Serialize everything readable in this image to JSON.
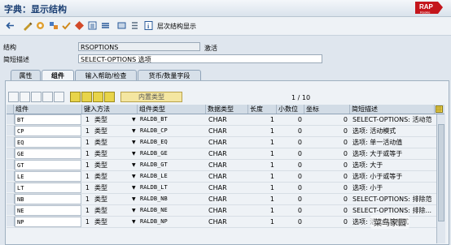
{
  "window": {
    "title": "字典：显示结构"
  },
  "logo": {
    "top": "RAP",
    "bottom": "Rookie"
  },
  "toolbar": {
    "hierarchy_label": "层次结构显示"
  },
  "header": {
    "structure_label": "结构",
    "structure_value": "RSOPTIONS",
    "status": "激活",
    "short_desc_label": "简短描述",
    "short_desc_value": "SELECT-OPTIONS 选项"
  },
  "tabs": [
    {
      "label": "属性",
      "active": false
    },
    {
      "label": "组件",
      "active": true
    },
    {
      "label": "输入帮助/检查",
      "active": false
    },
    {
      "label": "货币/数量字段",
      "active": false
    }
  ],
  "table_toolbar": {
    "builtin_type_label": "内置类型",
    "page_info": "1 / 10"
  },
  "table": {
    "columns": [
      "组件",
      "键入方法",
      "组件类型",
      "数据类型",
      "长度",
      "小数位",
      "坐标",
      "简短描述"
    ],
    "rows": [
      {
        "component": "BT",
        "method_num": "1",
        "method": "类型",
        "type": "RALDB_BT",
        "dtype": "CHAR",
        "len": "1",
        "dec": "0",
        "coord": "0",
        "desc": "SELECT-OPTIONS: 活动范"
      },
      {
        "component": "CP",
        "method_num": "1",
        "method": "类型",
        "type": "RALDB_CP",
        "dtype": "CHAR",
        "len": "1",
        "dec": "0",
        "coord": "0",
        "desc": "选项: 活动模式"
      },
      {
        "component": "EQ",
        "method_num": "1",
        "method": "类型",
        "type": "RALDB_EQ",
        "dtype": "CHAR",
        "len": "1",
        "dec": "0",
        "coord": "0",
        "desc": "选项: 单一活动值"
      },
      {
        "component": "GE",
        "method_num": "1",
        "method": "类型",
        "type": "RALDB_GE",
        "dtype": "CHAR",
        "len": "1",
        "dec": "0",
        "coord": "0",
        "desc": "选项: 大于或等于"
      },
      {
        "component": "GT",
        "method_num": "1",
        "method": "类型",
        "type": "RALDB_GT",
        "dtype": "CHAR",
        "len": "1",
        "dec": "0",
        "coord": "0",
        "desc": "选项: 大于"
      },
      {
        "component": "LE",
        "method_num": "1",
        "method": "类型",
        "type": "RALDB_LE",
        "dtype": "CHAR",
        "len": "1",
        "dec": "0",
        "coord": "0",
        "desc": "选项: 小于或等于"
      },
      {
        "component": "LT",
        "method_num": "1",
        "method": "类型",
        "type": "RALDB_LT",
        "dtype": "CHAR",
        "len": "1",
        "dec": "0",
        "coord": "0",
        "desc": "选项: 小于"
      },
      {
        "component": "NB",
        "method_num": "1",
        "method": "类型",
        "type": "RALDB_NB",
        "dtype": "CHAR",
        "len": "1",
        "dec": "0",
        "coord": "0",
        "desc": "SELECT-OPTIONS: 排除范"
      },
      {
        "component": "NE",
        "method_num": "1",
        "method": "类型",
        "type": "RALDB_NE",
        "dtype": "CHAR",
        "len": "1",
        "dec": "0",
        "coord": "0",
        "desc": "SELECT-OPTIONS: 排除..."
      },
      {
        "component": "NP",
        "method_num": "1",
        "method": "类型",
        "type": "RALDB_NP",
        "dtype": "CHAR",
        "len": "1",
        "dec": "0",
        "coord": "0",
        "desc": "选项: 活动排除模式"
      }
    ]
  },
  "watermark": {
    "text": "菜鸟家园"
  },
  "colors": {
    "title": "#1b3f73",
    "logo_red": "#c4161c",
    "accent_yellow": "#f4e6a1"
  }
}
